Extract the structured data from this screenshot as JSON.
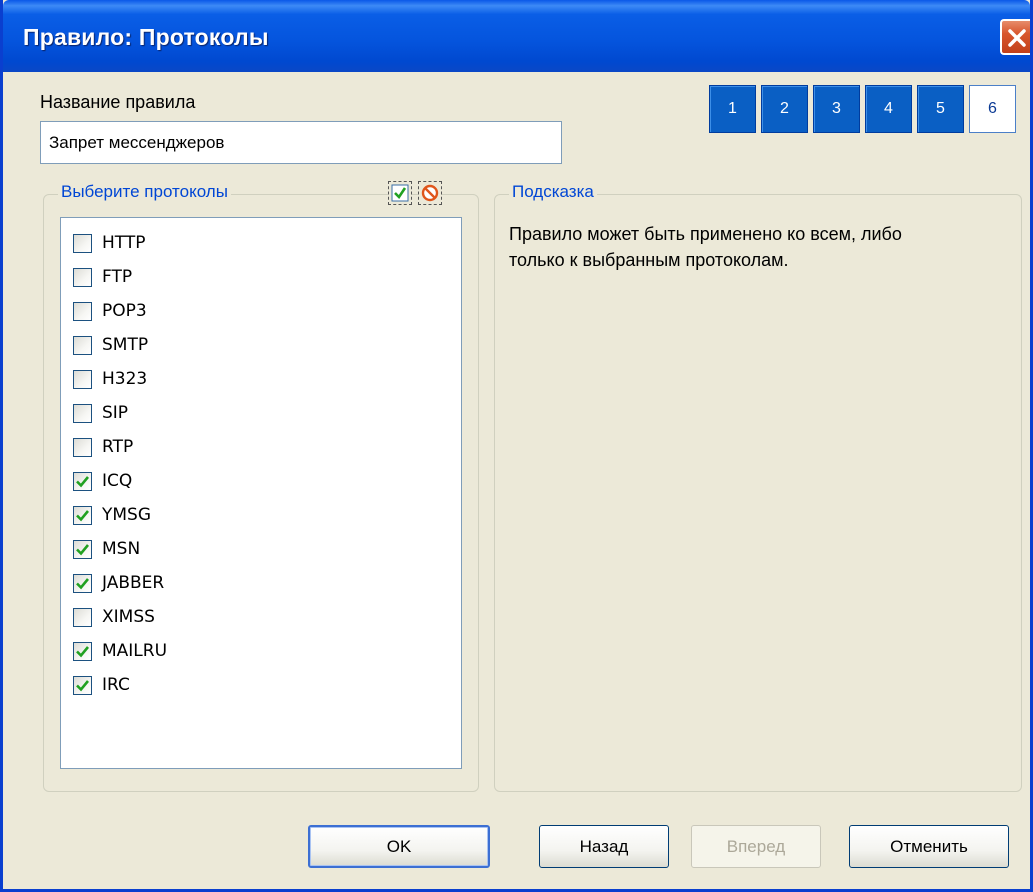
{
  "window": {
    "title": "Правило: Протоколы"
  },
  "rule_name": {
    "label": "Название правила",
    "value": "Запрет мессенджеров"
  },
  "steps": [
    {
      "label": "1",
      "active": false
    },
    {
      "label": "2",
      "active": false
    },
    {
      "label": "3",
      "active": false
    },
    {
      "label": "4",
      "active": false
    },
    {
      "label": "5",
      "active": false
    },
    {
      "label": "6",
      "active": true
    }
  ],
  "protocols": {
    "legend": "Выберите протоколы",
    "select_all_icon": "check-all-icon",
    "clear_all_icon": "clear-all-icon",
    "items": [
      {
        "label": "HTTP",
        "checked": false
      },
      {
        "label": "FTP",
        "checked": false
      },
      {
        "label": "POP3",
        "checked": false
      },
      {
        "label": "SMTP",
        "checked": false
      },
      {
        "label": "H323",
        "checked": false
      },
      {
        "label": "SIP",
        "checked": false
      },
      {
        "label": "RTP",
        "checked": false
      },
      {
        "label": "ICQ",
        "checked": true
      },
      {
        "label": "YMSG",
        "checked": true
      },
      {
        "label": "MSN",
        "checked": true
      },
      {
        "label": "JABBER",
        "checked": true
      },
      {
        "label": "XIMSS",
        "checked": false
      },
      {
        "label": "MAILRU",
        "checked": true
      },
      {
        "label": "IRC",
        "checked": true
      }
    ]
  },
  "hint": {
    "legend": "Подсказка",
    "text_line1": "Правило может быть применено ко всем, либо",
    "text_line2": "только к выбранным протоколам."
  },
  "buttons": {
    "ok": "OK",
    "back": "Назад",
    "next": "Вперед",
    "cancel": "Отменить"
  },
  "colors": {
    "titlebar": "#0555de",
    "accent": "#0046d5",
    "step_bg": "#0a5fc4",
    "check": "#21a121"
  }
}
